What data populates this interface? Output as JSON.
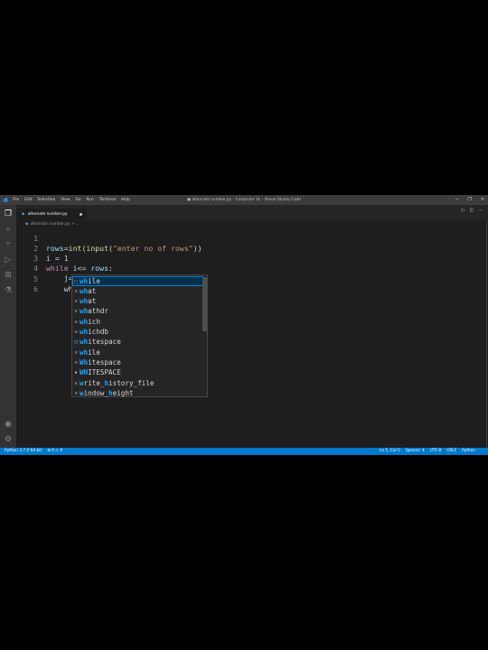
{
  "window": {
    "title": "● alternate number.py - Computer Sc - Visual Studio Code",
    "menu": [
      "File",
      "Edit",
      "Selection",
      "View",
      "Go",
      "Run",
      "Terminal",
      "Help"
    ],
    "controls": [
      "─",
      "❐",
      "✕"
    ]
  },
  "tab": {
    "label": "alternate number.py"
  },
  "breadcrumb": "alternate number.py > ...",
  "code": {
    "lines": [
      {
        "n": "1",
        "text": "rows=int(input(\"enter no of rows\"))"
      },
      {
        "n": "2",
        "text": "i = 1"
      },
      {
        "n": "3",
        "text": "while i<= rows:"
      },
      {
        "n": "4",
        "text": "    j=1"
      },
      {
        "n": "5",
        "text": "    wh"
      },
      {
        "n": "6",
        "text": ""
      }
    ]
  },
  "suggestions": [
    {
      "label": "while",
      "kind": "keyword",
      "selected": true
    },
    {
      "label": "what",
      "kind": "word"
    },
    {
      "label": "what",
      "kind": "word"
    },
    {
      "label": "whathdr",
      "kind": "word"
    },
    {
      "label": "which",
      "kind": "word"
    },
    {
      "label": "whichdb",
      "kind": "word"
    },
    {
      "label": "whitespace",
      "kind": "variable"
    },
    {
      "label": "while",
      "kind": "word"
    },
    {
      "label": "Whitespace",
      "kind": "word"
    },
    {
      "label": "WHITESPACE",
      "kind": "constant"
    },
    {
      "label": "write_history_file",
      "kind": "word"
    },
    {
      "label": "window_height",
      "kind": "word"
    }
  ],
  "status": {
    "left": [
      "Python 3.7.0 64-bit",
      "⊗ 0 ⚠ 0"
    ],
    "right": [
      "Ln 5, Col 5",
      "Spaces: 4",
      "UTF-8",
      "CRLF",
      "Python"
    ]
  },
  "colors": {
    "accent": "#007acc",
    "editor_bg": "#1e1e1e",
    "highlight": "#18a3ff"
  }
}
